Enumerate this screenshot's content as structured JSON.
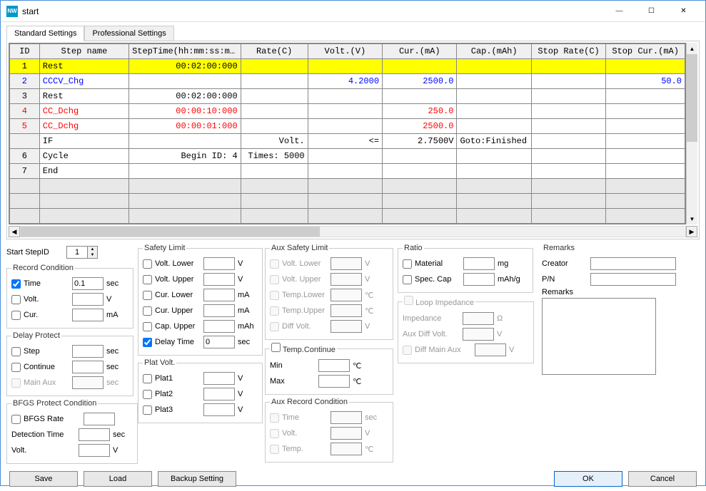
{
  "window": {
    "title": "start",
    "min": "—",
    "max": "☐",
    "close": "✕"
  },
  "tabs": {
    "standard": "Standard Settings",
    "professional": "Professional Settings"
  },
  "columns": [
    "ID",
    "Step name",
    "StepTime(hh:mm:ss:ms)",
    "Rate(C)",
    "Volt.(V)",
    "Cur.(mA)",
    "Cap.(mAh)",
    "Stop Rate(C)",
    "Stop Cur.(mA)"
  ],
  "rows": [
    {
      "id": "1",
      "name": "Rest",
      "time": "00:02:00:000",
      "rate": "",
      "volt": "",
      "cur": "",
      "cap": "",
      "srate": "",
      "scur": "",
      "cls": "yellow"
    },
    {
      "id": "2",
      "name": "CCCV_Chg",
      "time": "",
      "rate": "",
      "volt": "4.2000",
      "cur": "2500.0",
      "cap": "",
      "srate": "",
      "scur": "50.0",
      "cls": "blue"
    },
    {
      "id": "3",
      "name": "Rest",
      "time": "00:02:00:000",
      "rate": "",
      "volt": "",
      "cur": "",
      "cap": "",
      "srate": "",
      "scur": "",
      "cls": ""
    },
    {
      "id": "4",
      "name": "CC_Dchg",
      "time": "00:00:10:000",
      "rate": "",
      "volt": "",
      "cur": "250.0",
      "cap": "",
      "srate": "",
      "scur": "",
      "cls": "red"
    },
    {
      "id": "5",
      "name": "CC_Dchg",
      "time": "00:00:01:000",
      "rate": "",
      "volt": "",
      "cur": "2500.0",
      "cap": "",
      "srate": "",
      "scur": "",
      "cls": "red"
    },
    {
      "id": "",
      "name": "IF",
      "time": "",
      "rate": "Volt.",
      "volt": "<=",
      "cur": "2.7500V",
      "cap": "Goto:Finished",
      "srate": "",
      "scur": "",
      "cls": ""
    },
    {
      "id": "6",
      "name": "Cycle",
      "time": "Begin ID:          4",
      "rate": "Times:   5000",
      "volt": "",
      "cur": "",
      "cap": "",
      "srate": "",
      "scur": "",
      "cls": ""
    },
    {
      "id": "7",
      "name": "End",
      "time": "",
      "rate": "",
      "volt": "",
      "cur": "",
      "cap": "",
      "srate": "",
      "scur": "",
      "cls": ""
    }
  ],
  "start_step": {
    "label": "Start StepID",
    "value": "1"
  },
  "record": {
    "legend": "Record Condition",
    "time": "Time",
    "time_val": "0.1",
    "sec": "sec",
    "volt": "Volt.",
    "v": "V",
    "cur": "Cur.",
    "ma": "mA"
  },
  "delay": {
    "legend": "Delay Protect",
    "step": "Step",
    "cont": "Continue",
    "mainaux": "Main Aux",
    "sec": "sec"
  },
  "bfgs": {
    "legend": "BFGS Protect Condition",
    "rate": "BFGS Rate",
    "det": "Detection Time",
    "volt": "Volt.",
    "sec": "sec",
    "v": "V"
  },
  "safety": {
    "legend": "Safety Limit",
    "vl": "Volt. Lower",
    "vu": "Volt. Upper",
    "cl": "Cur. Lower",
    "cu": "Cur. Upper",
    "capu": "Cap. Upper",
    "dt": "Delay Time",
    "dt_val": "0",
    "v": "V",
    "ma": "mA",
    "mah": "mAh",
    "sec": "sec"
  },
  "plat": {
    "legend": "Plat Volt.",
    "p1": "Plat1",
    "p2": "Plat2",
    "p3": "Plat3",
    "v": "V"
  },
  "auxsafe": {
    "legend": "Aux Safety Limit",
    "vl": "Volt. Lower",
    "vu": "Volt. Upper",
    "tl": "Temp.Lower",
    "tu": "Temp.Upper",
    "dv": "Diff Volt.",
    "v": "V",
    "c": "℃"
  },
  "tempc": {
    "legend": "Temp.Continue",
    "min": "Min",
    "max": "Max",
    "c": "℃"
  },
  "auxrec": {
    "legend": "Aux Record Condition",
    "time": "Time",
    "volt": "Volt.",
    "temp": "Temp.",
    "sec": "sec",
    "v": "V",
    "c": "℃"
  },
  "ratio": {
    "legend": "Ratio",
    "mat": "Material",
    "sc": "Spec. Cap",
    "mg": "mg",
    "mahg": "mAh/g"
  },
  "loop": {
    "legend": "Loop Impedance",
    "imp": "Impedance",
    "adv": "Aux Diff Volt.",
    "dma": "Diff Main Aux",
    "ohm": "Ω",
    "v": "V"
  },
  "remarks": {
    "legend": "Remarks",
    "creator": "Creator",
    "pn": "P/N",
    "remarks": "Remarks"
  },
  "buttons": {
    "save": "Save",
    "load": "Load",
    "backup": "Backup Setting",
    "ok": "OK",
    "cancel": "Cancel"
  }
}
